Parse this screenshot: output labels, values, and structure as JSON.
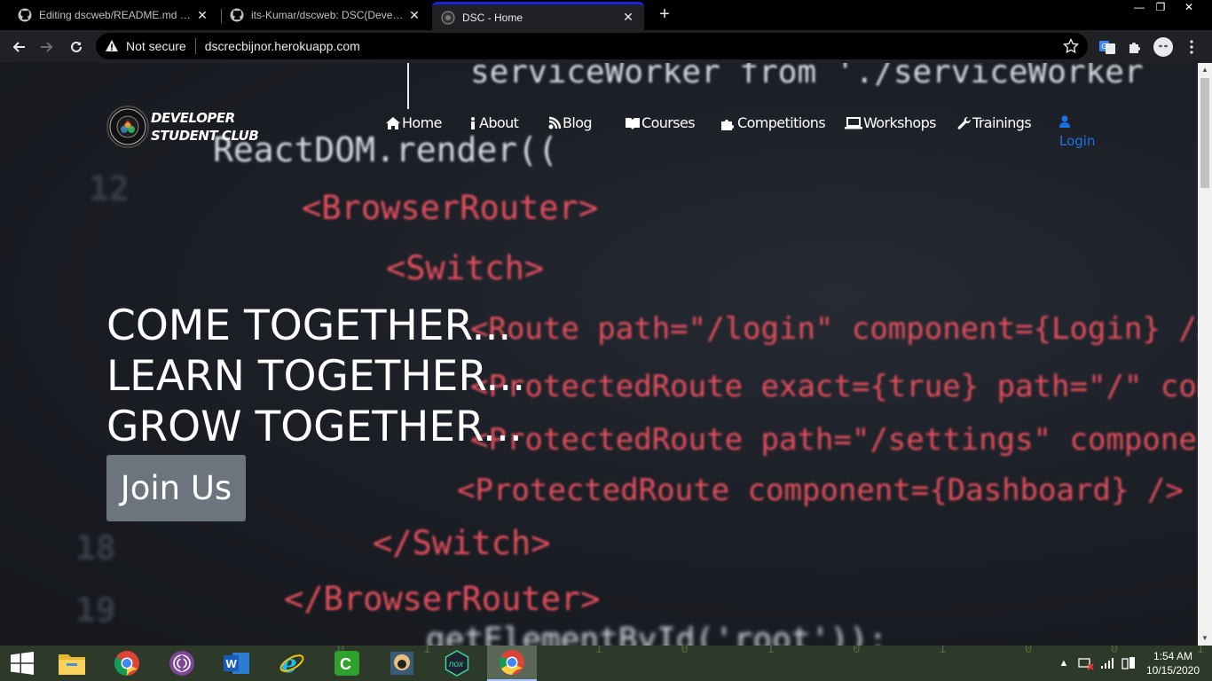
{
  "browser": {
    "tabs": [
      {
        "title": "Editing dscweb/README.md at m",
        "icon": "github-icon",
        "active": false
      },
      {
        "title": "its-Kumar/dscweb: DSC(Develope",
        "icon": "github-icon",
        "active": false
      },
      {
        "title": "DSC - Home",
        "icon": "dsc-logo-icon",
        "active": true
      }
    ],
    "security_label": "Not secure",
    "url": "dscrecbijnor.herokuapp.com"
  },
  "site": {
    "logo_text_line1": "DEVELOPER",
    "logo_text_line2": "STUDENT CLUB",
    "nav": [
      {
        "label": "Home",
        "icon": "home-icon"
      },
      {
        "label": "About",
        "icon": "info-icon"
      },
      {
        "label": "Blog",
        "icon": "blog-icon"
      },
      {
        "label": "Courses",
        "icon": "book-icon"
      },
      {
        "label": "Competitions",
        "icon": "puzzle-icon"
      },
      {
        "label": "Workshops",
        "icon": "laptop-icon"
      },
      {
        "label": "Trainings",
        "icon": "wrench-icon"
      }
    ],
    "login_label": "Login",
    "hero": [
      "COME TOGETHER...",
      "LEARN TOGETHER...",
      "GROW TOGETHER..."
    ],
    "join_label": "Join Us"
  },
  "code_background": {
    "lines": [
      "serviceWorker from './serviceWorker",
      "ReactDOM.render((",
      "<BrowserRouter>",
      "<Switch>",
      "<Route path=\"/login\" component={Login} />",
      "<ProtectedRoute exact={true} path=\"/\" component",
      "<ProtectedRoute path=\"/settings\" component={Se",
      "<ProtectedRoute component={Dashboard} />",
      "</Switch>",
      "</BrowserRouter>",
      "getElementById('root'));"
    ],
    "line_numbers": [
      "12",
      "18",
      "19"
    ]
  },
  "taskbar": {
    "apps": [
      "windows-start-icon",
      "file-explorer-icon",
      "chrome-icon",
      "tor-browser-icon",
      "word-icon",
      "internet-explorer-icon",
      "camtasia-icon",
      "game-icon",
      "nox-player-icon",
      "chrome-active-icon"
    ],
    "time": "1:54 AM",
    "date": "10/15/2020"
  }
}
